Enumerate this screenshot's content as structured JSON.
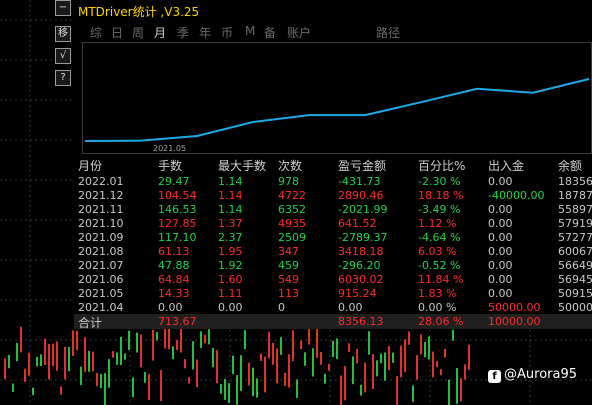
{
  "window": {
    "title": "MTDriver统计 ,V3.25"
  },
  "side_buttons": [
    "−",
    "移",
    "√",
    "?"
  ],
  "tabs": [
    {
      "label": "综",
      "active": false
    },
    {
      "label": "日",
      "active": false
    },
    {
      "label": "周",
      "active": false
    },
    {
      "label": "月",
      "active": true
    },
    {
      "label": "季",
      "active": false
    },
    {
      "label": "年",
      "active": false
    },
    {
      "label": "币",
      "active": false
    },
    {
      "label": "M",
      "active": false
    },
    {
      "label": "备",
      "active": false
    },
    {
      "label": "账户",
      "active": false
    },
    {
      "label": "路径",
      "active": false
    }
  ],
  "chart_data": {
    "type": "line",
    "x_tick_label": "2021.05",
    "series_color": "#1ea8e6",
    "values": [
      0,
      0.5,
      6.4,
      24.4,
      33.2,
      33.2,
      49.7,
      66.9,
      61.9,
      79.5
    ]
  },
  "table": {
    "headers": [
      "月份",
      "手数",
      "最大手数",
      "次数",
      "盈亏金额",
      "百分比%",
      "出入金",
      "余额"
    ],
    "rows": [
      {
        "month": "2022.01",
        "lots": "29.47",
        "max": "1.14",
        "count": "978",
        "pnl": "-431.73",
        "pct": "-2.30 %",
        "flow": "0.00",
        "balance": "18356.",
        "color": "green",
        "flow_color": "grey"
      },
      {
        "month": "2021.12",
        "lots": "104.54",
        "max": "1.14",
        "count": "4722",
        "pnl": "2890.46",
        "pct": "18.18 %",
        "flow": "-40000.00",
        "balance": "18787.",
        "color": "red",
        "flow_color": "green"
      },
      {
        "month": "2021.11",
        "lots": "146.53",
        "max": "1.14",
        "count": "6352",
        "pnl": "-2021.99",
        "pct": "-3.49 %",
        "flow": "0.00",
        "balance": "55897.",
        "color": "green",
        "flow_color": "grey"
      },
      {
        "month": "2021.10",
        "lots": "127.85",
        "max": "1.37",
        "count": "4935",
        "pnl": "641.52",
        "pct": "1.12 %",
        "flow": "0.00",
        "balance": "57919.",
        "color": "red",
        "flow_color": "grey"
      },
      {
        "month": "2021.09",
        "lots": "117.10",
        "max": "2.37",
        "count": "2509",
        "pnl": "-2789.37",
        "pct": "-4.64 %",
        "flow": "0.00",
        "balance": "57277.",
        "color": "green",
        "flow_color": "grey"
      },
      {
        "month": "2021.08",
        "lots": "61.13",
        "max": "1.95",
        "count": "347",
        "pnl": "3418.18",
        "pct": "6.03 %",
        "flow": "0.00",
        "balance": "60067.",
        "color": "red",
        "flow_color": "grey"
      },
      {
        "month": "2021.07",
        "lots": "47.88",
        "max": "1.92",
        "count": "459",
        "pnl": "-296.20",
        "pct": "-0.52 %",
        "flow": "0.00",
        "balance": "56649.",
        "color": "green",
        "flow_color": "grey"
      },
      {
        "month": "2021.06",
        "lots": "64.84",
        "max": "1.60",
        "count": "549",
        "pnl": "6030.02",
        "pct": "11.84 %",
        "flow": "0.00",
        "balance": "56945.",
        "color": "red",
        "flow_color": "grey"
      },
      {
        "month": "2021.05",
        "lots": "14.33",
        "max": "1.11",
        "count": "113",
        "pnl": "915.24",
        "pct": "1.83 %",
        "flow": "0.00",
        "balance": "50915.",
        "color": "red",
        "flow_color": "grey"
      },
      {
        "month": "2021.04",
        "lots": "0.00",
        "max": "0.00",
        "count": "0",
        "pnl": "0.00",
        "pct": "0.00 %",
        "flow": "50000.00",
        "balance": "50000.",
        "color": "grey",
        "flow_color": "red"
      }
    ],
    "summary": {
      "label": "合计",
      "lots": "713.67",
      "pnl": "8356.13",
      "pct": "28.06 %",
      "flow": "10000.00"
    }
  },
  "watermark": "@Aurora95"
}
